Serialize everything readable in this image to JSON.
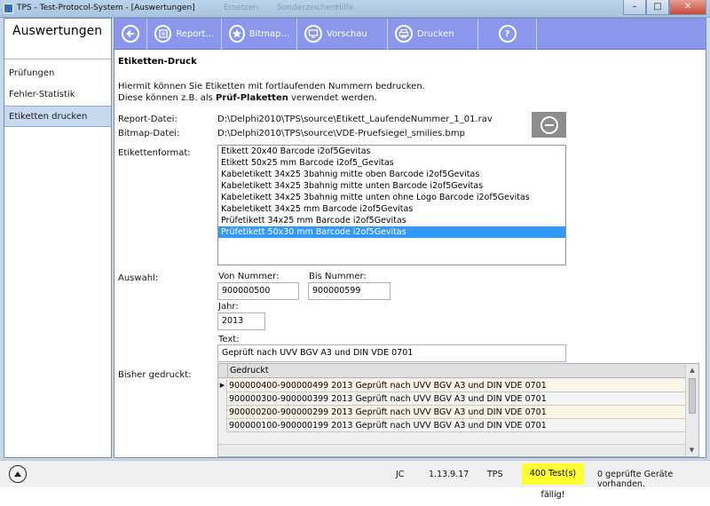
{
  "window": {
    "title": "TPS - Test-Protocol-System - [Auswertungen]",
    "ghost_tabs": [
      "Ersetzen",
      "Sonderzeichen",
      "Hilfe"
    ],
    "minimize_glyph": "–",
    "maximize_glyph": "□",
    "close_glyph": "✕"
  },
  "sidebar": {
    "title": "Auswertungen",
    "items": [
      {
        "label": "Prüfungen",
        "selected": false
      },
      {
        "label": "Fehler-Statistik",
        "selected": false
      },
      {
        "label": "Etiketten drucken",
        "selected": true
      }
    ]
  },
  "toolbar": {
    "back_icon": "arrow-left-icon",
    "buttons": [
      {
        "label": "Report...",
        "icon": "report-icon"
      },
      {
        "label": "Bitmap...",
        "icon": "star-icon"
      },
      {
        "label": "Vorschau",
        "icon": "monitor-icon"
      },
      {
        "label": "Drucken",
        "icon": "printer-icon"
      }
    ],
    "help_glyph": "?"
  },
  "content": {
    "section_title": "Etiketten-Druck",
    "intro_line1": "Hiermit können Sie Etiketten mit fortlaufenden Nummern bedrucken.",
    "intro_line2_pre": "Diese können z.B. als ",
    "intro_line2_bold": "Prüf-Plaketten",
    "intro_line2_post": " verwendet werden.",
    "report_label": "Report-Datei:",
    "report_value": "D:\\Delphi2010\\TPS\\source\\Etikett_LaufendeNummer_1_01.rav",
    "bitmap_label": "Bitmap-Datei:",
    "bitmap_value": "D:\\Delphi2010\\TPS\\source\\VDE-Pruefsiegel_smilies.bmp",
    "format_label": "Etikettenformat:",
    "formats": [
      {
        "label": "Etikett 20x40 Barcode i2of5Gevitas",
        "selected": false
      },
      {
        "label": "Etikett 50x25 mm Barcode i2of5_Gevitas",
        "selected": false
      },
      {
        "label": "Kabeletikett 34x25 3bahnig mitte oben Barcode i2of5Gevitas",
        "selected": false
      },
      {
        "label": "Kabeletikett 34x25 3bahnig mitte unten Barcode i2of5Gevitas",
        "selected": false
      },
      {
        "label": "Kabeletikett 34x25 3bahnig mitte unten ohne Logo Barcode i2of5Gevitas",
        "selected": false
      },
      {
        "label": "Kabeletikett 34x25 mm Barcode i2of5Gevitas",
        "selected": false
      },
      {
        "label": "Prüfetikett 34x25 mm Barcode i2of5Gevitas",
        "selected": false
      },
      {
        "label": "Prüfetikett 50x30 mm Barcode i2of5Gevitas",
        "selected": true
      }
    ],
    "selection_label": "Auswahl:",
    "from_label": "Von Nummer:",
    "from_value": "900000500",
    "to_label": "Bis Nummer:",
    "to_value": "900000599",
    "year_label": "Jahr:",
    "year_value": "2013",
    "text_label": "Text:",
    "text_value": "Geprüft nach UVV BGV A3 und DIN VDE 0701",
    "printed_label": "Bisher gedruckt:",
    "printed_header": "Gedruckt",
    "printed_rows": [
      "900000400-900000499 2013 Geprüft nach UVV BGV A3 und DIN VDE 0701",
      "900000300-900000399 2013 Geprüft nach UVV BGV A3 und DIN VDE 0701",
      "900000200-900000299 2013 Geprüft nach UVV BGV A3 und DIN VDE 0701",
      "900000100-900000199 2013 Geprüft nach UVV BGV A3 und DIN VDE 0701"
    ],
    "current_row_marker": "▶"
  },
  "status": {
    "user": "JC",
    "version": "1.13.9.17",
    "app": "TPS",
    "warning": "400 Test(s) fällig!",
    "warning_color": "#ffff33",
    "info": "0 geprüfte Geräte vorhanden."
  }
}
